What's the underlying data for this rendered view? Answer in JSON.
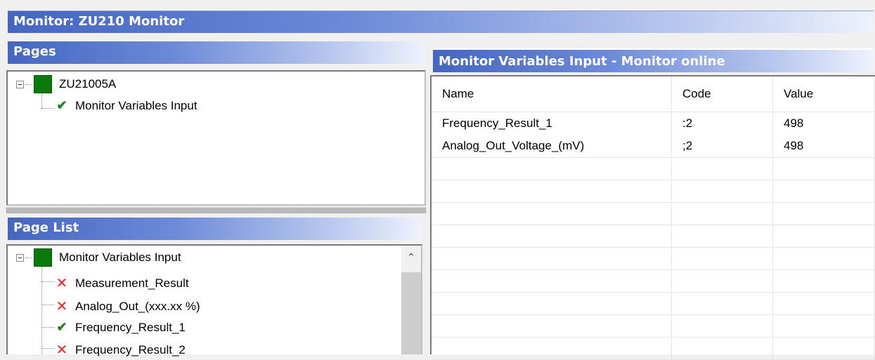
{
  "window": {
    "title": "Monitor: ZU210 Monitor"
  },
  "pages": {
    "title": "Pages",
    "root": {
      "label": "ZU21005A",
      "icon": "green-square-icon"
    },
    "children": [
      {
        "label": "Monitor Variables Input",
        "status": "check"
      }
    ]
  },
  "page_list": {
    "title": "Page List",
    "root": {
      "label": "Monitor Variables Input",
      "icon": "green-square-icon"
    },
    "items": [
      {
        "label": "Measurement_Result",
        "status": "cross"
      },
      {
        "label": "Analog_Out_(xxx.xx %)",
        "status": "cross"
      },
      {
        "label": "Frequency_Result_1",
        "status": "check"
      },
      {
        "label": "Frequency_Result_2",
        "status": "cross"
      }
    ]
  },
  "monitor_variables": {
    "title": "Monitor Variables Input - Monitor online",
    "columns": [
      "Name",
      "Code",
      "Value"
    ],
    "rows": [
      {
        "name": "Frequency_Result_1",
        "code": ":2",
        "value": "498"
      },
      {
        "name": "Analog_Out_Voltage_(mV)",
        "code": ";2",
        "value": "498"
      }
    ]
  },
  "colors": {
    "status_ok": "#1d7f1d",
    "status_error": "#e22222",
    "node_green": "#0a7a0a",
    "title_gradient_start": "#4466c2"
  }
}
